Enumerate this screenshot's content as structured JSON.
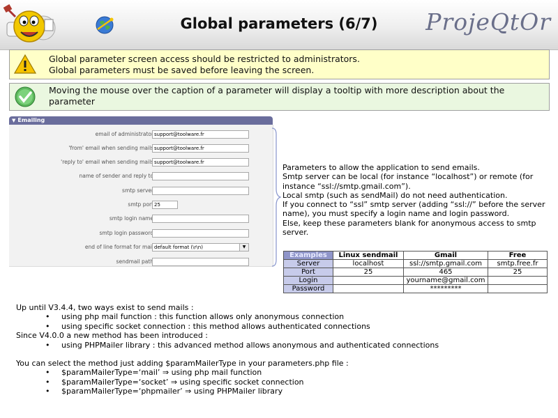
{
  "header": {
    "title": "Global parameters (6/7)",
    "brand": "ProjeQtOr"
  },
  "warning": {
    "line1": "Global parameter screen access should be restricted to administrators.",
    "line2": "Global parameters must be saved before leaving the screen."
  },
  "info": {
    "text": "Moving the mouse over the caption of a parameter will display a tooltip with more description about the parameter"
  },
  "panel": {
    "title": "Emailing",
    "fields": [
      {
        "label": "email of administrator :",
        "value": "support@toolware.fr"
      },
      {
        "label": "'from' email when sending mails :",
        "value": "support@toolware.fr"
      },
      {
        "label": "'reply to' email when sending mails :",
        "value": "support@toolware.fr"
      },
      {
        "label": "name of sender and reply to :",
        "value": ""
      },
      {
        "label": "smtp server :",
        "value": ""
      },
      {
        "label": "smtp port :",
        "value": "25"
      },
      {
        "label": "smtp login name :",
        "value": ""
      },
      {
        "label": "smtp login password :",
        "value": ""
      },
      {
        "label": "end of line format for mail :",
        "value": "default format (\\r\\n)"
      },
      {
        "label": "sendmail path :",
        "value": ""
      }
    ]
  },
  "description": {
    "lines": [
      "Parameters to allow the application to send emails.",
      "Smtp server can be local (for instance “localhost”) or remote (for instance “ssl://smtp.gmail.com”).",
      "Local smtp (such as sendMail) do not need authentication.",
      "If you connect to “ssl” smtp server (adding “ssl://” before the server name), you must specify a login name and login password.",
      "Else, keep these parameters blank for anonymous access to smtp server."
    ]
  },
  "examples": {
    "headers": [
      "Examples",
      "Linux sendmail",
      "Gmail",
      "Free"
    ],
    "rows": [
      [
        "Server",
        "localhost",
        "ssl://smtp.gmail.com",
        "smtp.free.fr"
      ],
      [
        "Port",
        "25",
        "465",
        "25"
      ],
      [
        "Login",
        "",
        "yourname@gmail.com",
        ""
      ],
      [
        "Password",
        "",
        "*********",
        ""
      ]
    ]
  },
  "notes": {
    "p1": "Up until V3.4.4, two ways exist to send mails :",
    "p1_b1": "using php mail function : this function allows only anonymous connection",
    "p1_b2": "using specific socket connection : this method allows authenticated connections",
    "p2": "Since V4.0.0 a new method has been introduced :",
    "p2_b1": "using PHPMailer library : this advanced method allows anonymous and authenticated connections",
    "p3": "You can select the method just adding $paramMailerType in your parameters.php file :",
    "p3_b1": "$paramMailerType=‘mail’ ⇒ using php mail function",
    "p3_b2": "$paramMailerType=‘socket’ ⇒ using specific socket connection",
    "p3_b3": "$paramMailerType=‘phpmailer’ ⇒ using PHPMailer library"
  },
  "icons": {
    "logo": "mascot-logo-icon",
    "globe": "globe-icon",
    "warning": "warning-icon",
    "info": "checkmark-icon"
  },
  "colors": {
    "warning_bg": "#ffffc8",
    "info_bg": "#eaf7e0",
    "panel_header": "#6a6d9c",
    "brand": "#6a6f8a"
  }
}
